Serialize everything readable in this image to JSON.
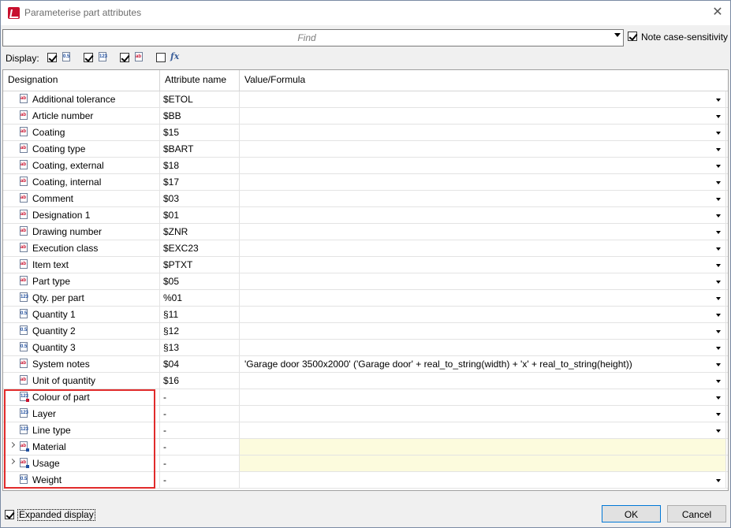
{
  "window": {
    "title": "Parameterise part attributes"
  },
  "find": {
    "placeholder": "Find"
  },
  "note_case": {
    "label": "Note case-sensitivity",
    "checked": true
  },
  "display": {
    "label": "Display:",
    "filters": [
      {
        "name": "numeric-attributes",
        "checked": true,
        "icon": "numeric-attribute-icon",
        "glyph": "0.5"
      },
      {
        "name": "catalogue-attributes",
        "checked": true,
        "icon": "catalogue-attribute-icon",
        "glyph": "123"
      },
      {
        "name": "text-attributes",
        "checked": true,
        "icon": "text-attribute-icon",
        "glyph": "ab"
      },
      {
        "name": "formula-attributes",
        "checked": false,
        "icon": "formula-icon",
        "glyph": "fx"
      }
    ]
  },
  "table": {
    "columns": [
      "Designation",
      "Attribute name",
      "Value/Formula"
    ],
    "rows": [
      {
        "designation": "Additional tolerance",
        "attr": "$ETOL",
        "value": "",
        "icon": "text",
        "dropdown": true
      },
      {
        "designation": "Article number",
        "attr": "$BB",
        "value": "",
        "icon": "text",
        "dropdown": true
      },
      {
        "designation": "Coating",
        "attr": "$15",
        "value": "",
        "icon": "text",
        "dropdown": true
      },
      {
        "designation": "Coating type",
        "attr": "$BART",
        "value": "",
        "icon": "text",
        "dropdown": true
      },
      {
        "designation": "Coating, external",
        "attr": "$18",
        "value": "",
        "icon": "text",
        "dropdown": true
      },
      {
        "designation": "Coating, internal",
        "attr": "$17",
        "value": "",
        "icon": "text",
        "dropdown": true
      },
      {
        "designation": "Comment",
        "attr": "$03",
        "value": "",
        "icon": "text",
        "dropdown": true
      },
      {
        "designation": "Designation 1",
        "attr": "$01",
        "value": "",
        "icon": "text",
        "dropdown": true
      },
      {
        "designation": "Drawing number",
        "attr": "$ZNR",
        "value": "",
        "icon": "text",
        "dropdown": true
      },
      {
        "designation": "Execution class",
        "attr": "$EXC23",
        "value": "",
        "icon": "text",
        "dropdown": true
      },
      {
        "designation": "Item text",
        "attr": "$PTXT",
        "value": "",
        "icon": "text",
        "dropdown": true
      },
      {
        "designation": "Part type",
        "attr": "$05",
        "value": "",
        "icon": "text",
        "dropdown": true
      },
      {
        "designation": "Qty. per part",
        "attr": "%01",
        "value": "",
        "icon": "catalogue",
        "dropdown": true
      },
      {
        "designation": "Quantity 1",
        "attr": "§11",
        "value": "",
        "icon": "numeric",
        "dropdown": true
      },
      {
        "designation": "Quantity 2",
        "attr": "§12",
        "value": "",
        "icon": "numeric",
        "dropdown": true
      },
      {
        "designation": "Quantity 3",
        "attr": "§13",
        "value": "",
        "icon": "numeric",
        "dropdown": true
      },
      {
        "designation": "System notes",
        "attr": "$04",
        "value": "'Garage door 3500x2000' ('Garage door' + real_to_string(width) + 'x' + real_to_string(height))",
        "icon": "text",
        "dropdown": true
      },
      {
        "designation": "Unit of quantity",
        "attr": "$16",
        "value": "",
        "icon": "text",
        "dropdown": true
      },
      {
        "designation": "Colour of part",
        "attr": "-",
        "value": "",
        "icon": "catalogue-red",
        "dropdown": true
      },
      {
        "designation": "Layer",
        "attr": "-",
        "value": "",
        "icon": "catalogue",
        "dropdown": true
      },
      {
        "designation": "Line type",
        "attr": "-",
        "value": "",
        "icon": "catalogue",
        "dropdown": true
      },
      {
        "designation": "Material",
        "attr": "-",
        "value": "",
        "icon": "text-blue",
        "dropdown": false,
        "expandable": true,
        "yellow": true
      },
      {
        "designation": "Usage",
        "attr": "-",
        "value": "",
        "icon": "text-blue",
        "dropdown": false,
        "expandable": true,
        "yellow": true
      },
      {
        "designation": "Weight",
        "attr": "-",
        "value": "",
        "icon": "numeric",
        "dropdown": true
      }
    ]
  },
  "expanded_display": {
    "label": "Expanded display",
    "checked": true
  },
  "buttons": {
    "ok": "OK",
    "cancel": "Cancel"
  },
  "colors": {
    "highlight": "#e12b2b",
    "yellow_cell": "#fcfbdd",
    "accent": "#0078d7"
  }
}
